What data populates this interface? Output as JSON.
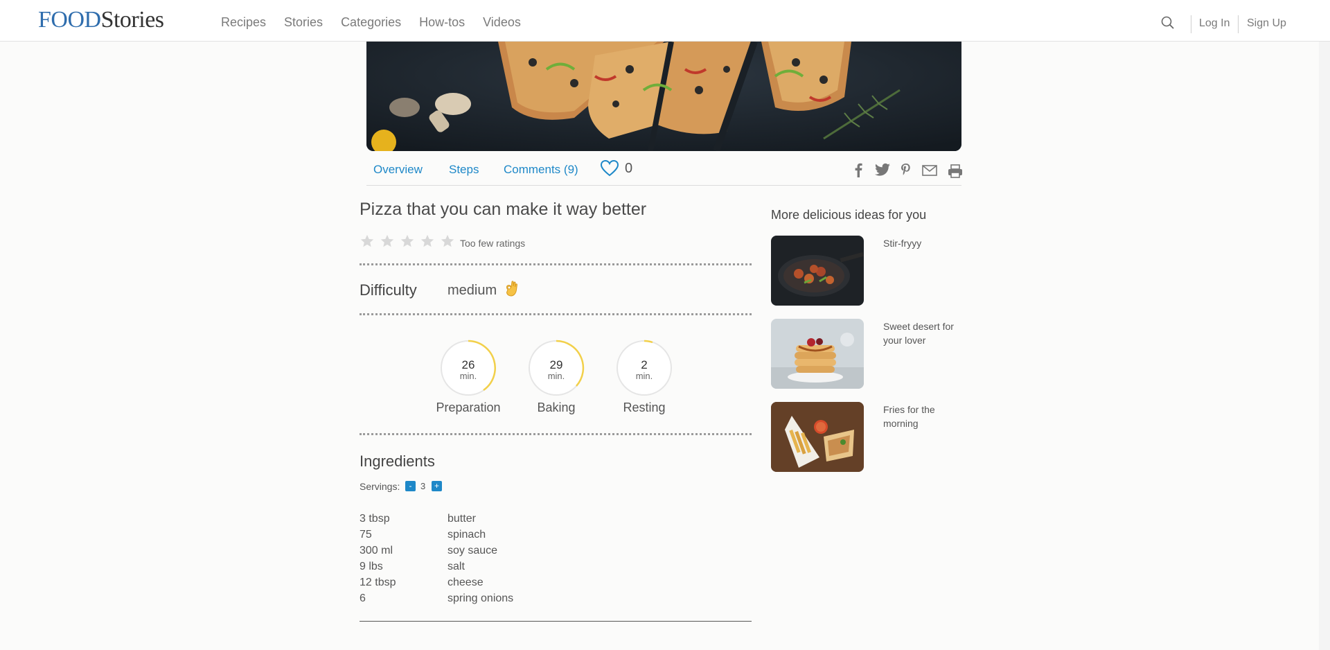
{
  "header": {
    "logo_primary": "FOOD",
    "logo_secondary": "Stories",
    "nav": [
      "Recipes",
      "Stories",
      "Categories",
      "How-tos",
      "Videos"
    ],
    "login": "Log In",
    "signup": "Sign Up"
  },
  "tabs": {
    "overview": "Overview",
    "steps": "Steps",
    "comments": "Comments (9)",
    "likes": "0"
  },
  "recipe": {
    "title": "Pizza that you can make it way better",
    "rating_text": "Too few ratings",
    "rating_stars": 0,
    "difficulty_label": "Difficulty",
    "difficulty_value": "medium",
    "timers": [
      {
        "value": "26",
        "unit": "min.",
        "label": "Preparation"
      },
      {
        "value": "29",
        "unit": "min.",
        "label": "Baking"
      },
      {
        "value": "2",
        "unit": "min.",
        "label": "Resting"
      }
    ],
    "ingredients_title": "Ingredients",
    "servings_label": "Servings:",
    "servings_minus": "-",
    "servings_value": "3",
    "servings_plus": "+",
    "ingredients": [
      {
        "qty": "3 tbsp",
        "name": "butter"
      },
      {
        "qty": "75",
        "name": "spinach"
      },
      {
        "qty": "300 ml",
        "name": "soy sauce"
      },
      {
        "qty": "9 lbs",
        "name": "salt"
      },
      {
        "qty": "12 tbsp",
        "name": "cheese"
      },
      {
        "qty": "6",
        "name": "spring onions"
      }
    ]
  },
  "sidebar": {
    "title": "More delicious ideas for you",
    "cards": [
      {
        "title": "Stir-fryyy"
      },
      {
        "title": "Sweet desert for your lover"
      },
      {
        "title": "Fries for the morning"
      }
    ]
  },
  "colors": {
    "brand_blue": "#2f6dad",
    "link_blue": "#1e88c8",
    "timer_yellow": "#f2d04a"
  }
}
